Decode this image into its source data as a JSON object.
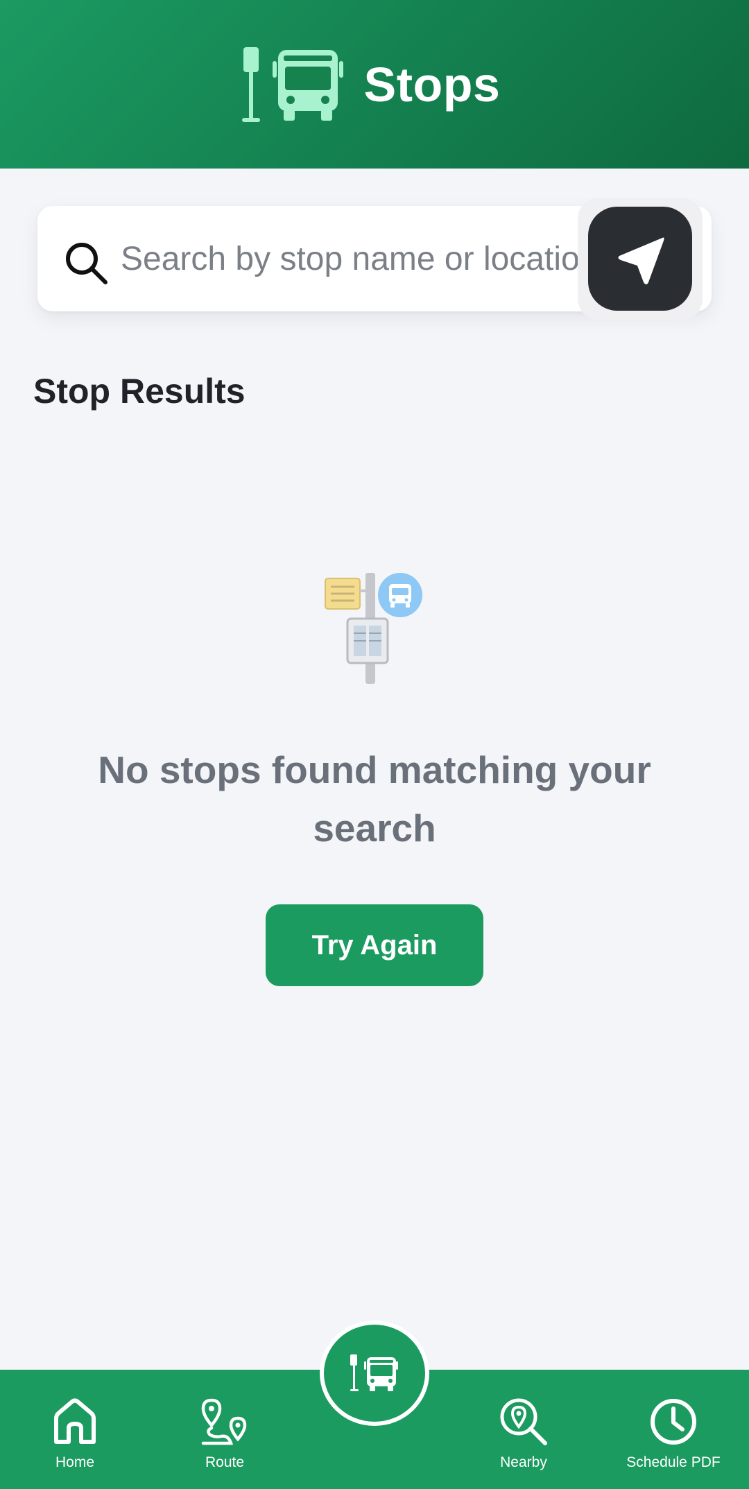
{
  "header": {
    "title": "Stops",
    "icon": "bus-stop-icon"
  },
  "search": {
    "placeholder": "Search by stop name or location",
    "value": "",
    "search_icon": "search-icon",
    "locate_icon": "navigation-arrow-icon"
  },
  "results": {
    "section_title": "Stop Results",
    "empty_message": "No stops found matching your search",
    "retry_label": "Try Again",
    "illustration": "bus-stop-sign-illustration"
  },
  "bottom_nav": {
    "items": [
      {
        "label": "Home",
        "icon": "home-icon"
      },
      {
        "label": "Route",
        "icon": "route-icon"
      },
      {
        "label": "Nearby",
        "icon": "nearby-search-icon"
      },
      {
        "label": "Schedule PDF",
        "icon": "clock-icon"
      }
    ],
    "center_icon": "bus-stop-icon"
  },
  "colors": {
    "primary_green": "#1c9b60",
    "header_dark_green": "#0e6a3f",
    "icon_mint": "#a8f2d0",
    "locate_button": "#2a2d31",
    "background": "#f4f5f9",
    "muted_text": "#6a707a"
  }
}
